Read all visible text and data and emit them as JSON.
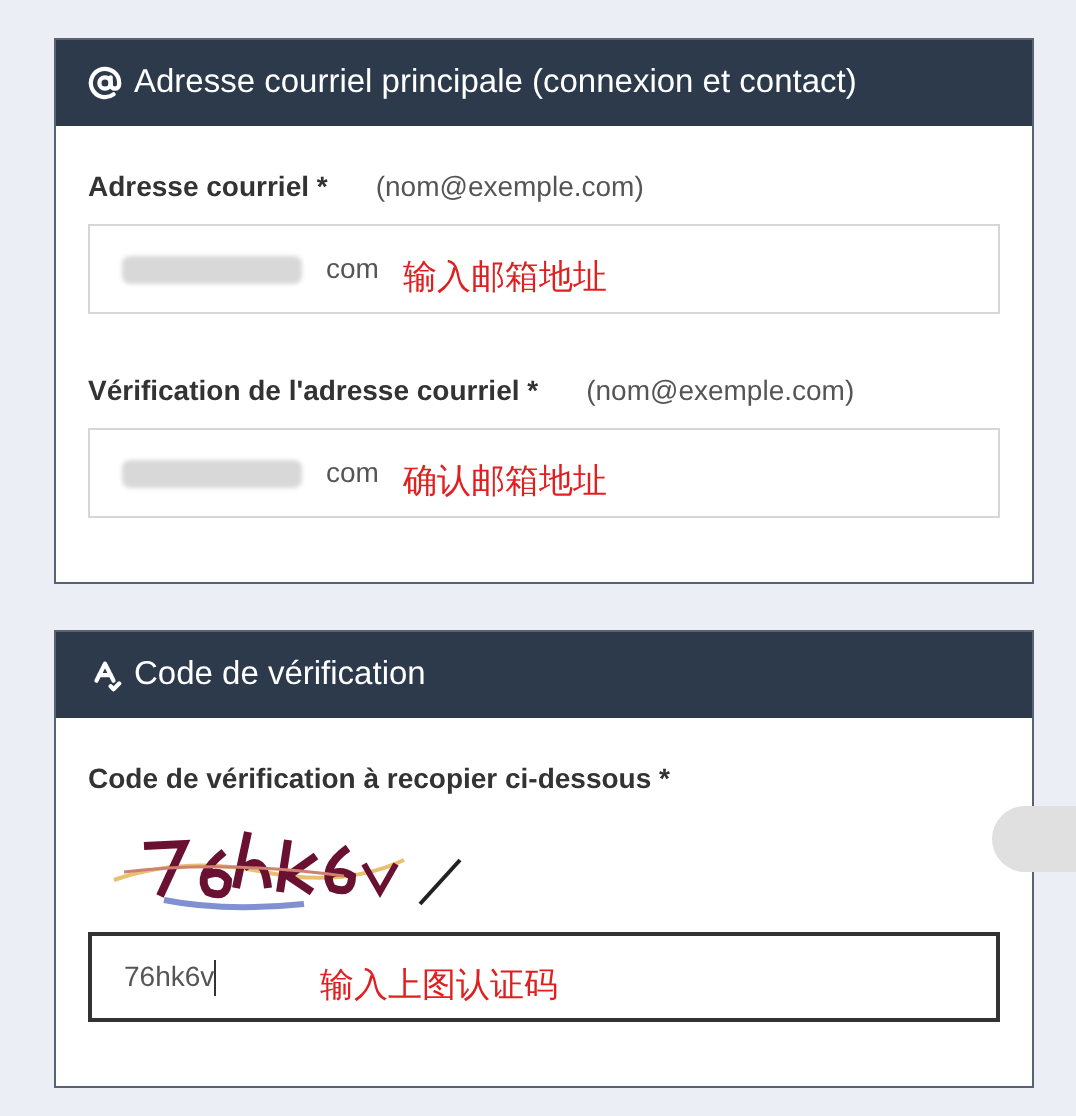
{
  "sections": [
    {
      "kind": "email",
      "title": "Adresse courriel principale (connexion et contact)",
      "fields": [
        {
          "kind": "email",
          "label": "Adresse courriel *",
          "hint": "(nom@exemple.com)",
          "value": "com",
          "annotation": "输入邮箱地址",
          "focused": false
        },
        {
          "kind": "email",
          "label": "Vérification de l'adresse courriel *",
          "hint": "(nom@exemple.com)",
          "value": "com",
          "annotation": "确认邮箱地址",
          "focused": false
        }
      ]
    },
    {
      "kind": "captcha",
      "title": "Code de vérification",
      "fields": [
        {
          "kind": "captcha",
          "label": "Code de vérification à recopier ci-dessous *",
          "value": "76hk6v",
          "annotation": "输入上图认证码",
          "focused": true
        }
      ]
    }
  ]
}
